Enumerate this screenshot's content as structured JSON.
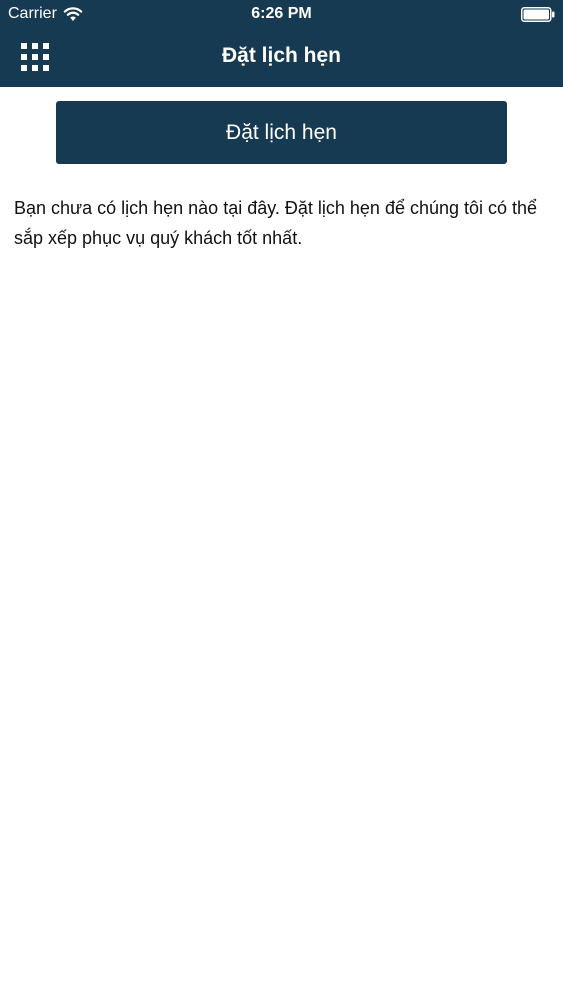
{
  "status_bar": {
    "carrier": "Carrier",
    "time": "6:26 PM",
    "icons": [
      "wifi-icon",
      "battery-icon"
    ]
  },
  "nav_bar": {
    "menu_icon": "grid-icon",
    "title": "Đặt lịch hẹn"
  },
  "main": {
    "book_button_label": "Đặt lịch hẹn",
    "empty_message": "Bạn chưa có lịch hẹn nào tại đây. Đặt lịch hẹn để chúng tôi có thể sắp xếp phục vụ quý khách tốt nhất."
  },
  "colors": {
    "primary": "#163a52",
    "background": "#ffffff",
    "text": "#111111",
    "on_primary": "#ffffff"
  }
}
